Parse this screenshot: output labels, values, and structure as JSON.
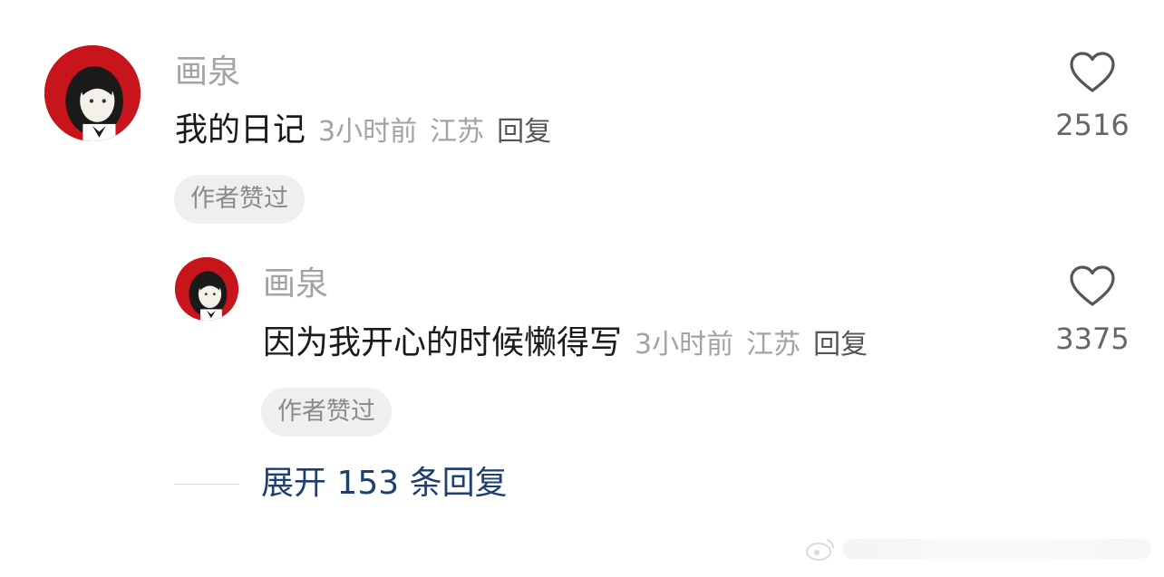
{
  "comment": {
    "username": "画泉",
    "text": "我的日记",
    "time": "3小时前",
    "location": "江苏",
    "reply_label": "回复",
    "badge": "作者赞过",
    "likes": "2516"
  },
  "reply": {
    "username": "画泉",
    "text": "因为我开心的时候懒得写",
    "time": "3小时前",
    "location": "江苏",
    "reply_label": "回复",
    "badge": "作者赞过",
    "likes": "3375"
  },
  "expand_label": "展开 153 条回复",
  "colors": {
    "username": "#a3a3a3",
    "body": "#1a1a1a",
    "link": "#1f3f6e",
    "badge_bg": "#efefef",
    "avatar_bg": "#c8141b"
  },
  "icons": {
    "avatar": "avatar-anime-girl",
    "like": "heart-outline-icon",
    "watermark": "weibo-watermark"
  }
}
